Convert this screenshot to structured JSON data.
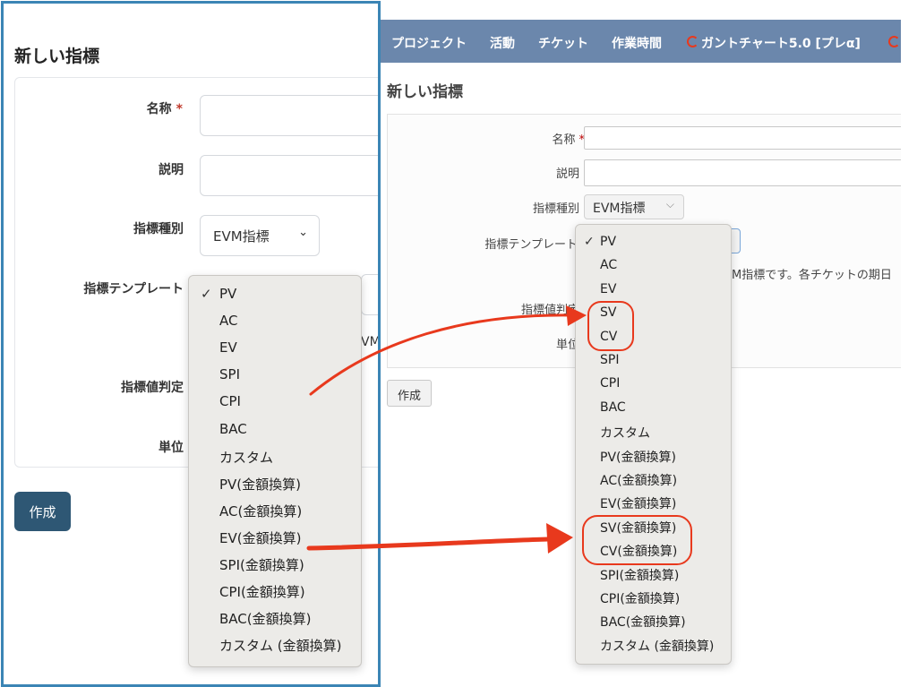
{
  "colors": {
    "accent": "#3b85b5",
    "nav_bg": "#6b87ac",
    "primary_button": "#2e5774",
    "annotation": "#e8391d",
    "required": "#bb0000"
  },
  "left": {
    "title": "新しい指標",
    "labels": {
      "name": "名称",
      "required_mark": "*",
      "description": "説明",
      "indicator_type": "指標種別",
      "indicator_template": "指標テンプレート",
      "value_judgement": "指標値判定",
      "unit": "単位"
    },
    "indicator_type_value": "EVM指標",
    "desc_fragment": "VM",
    "create_button": "作成",
    "template_options": [
      "PV",
      "AC",
      "EV",
      "SPI",
      "CPI",
      "BAC",
      "カスタム",
      "PV(金額換算)",
      "AC(金額換算)",
      "EV(金額換算)",
      "SPI(金額換算)",
      "CPI(金額換算)",
      "BAC(金額換算)",
      "カスタム (金額換算)"
    ],
    "selected_option": "PV",
    "check_icon": "checkmark-icon"
  },
  "right": {
    "nav": {
      "project": "プロジェクト",
      "activity": "活動",
      "ticket": "チケット",
      "time": "作業時間",
      "gantt": "ガントチャート5.0 [プレα]",
      "gantt_icon": "gantt-logo-icon"
    },
    "title": "新しい指標",
    "labels": {
      "name": "名称",
      "required_mark": "*",
      "description": "説明",
      "indicator_type": "指標種別",
      "indicator_template": "指標テンプレート",
      "value_judgement": "指標値判定",
      "unit": "単位"
    },
    "indicator_type_value": "EVM指標",
    "template_desc": "M指標です。各チケットの期日",
    "create_button": "作成",
    "template_options": [
      "PV",
      "AC",
      "EV",
      "SV",
      "CV",
      "SPI",
      "CPI",
      "BAC",
      "カスタム",
      "PV(金額換算)",
      "AC(金額換算)",
      "EV(金額換算)",
      "SV(金額換算)",
      "CV(金額換算)",
      "SPI(金額換算)",
      "CPI(金額換算)",
      "BAC(金額換算)",
      "カスタム (金額換算)"
    ],
    "selected_option": "PV",
    "check_icon": "checkmark-icon"
  }
}
